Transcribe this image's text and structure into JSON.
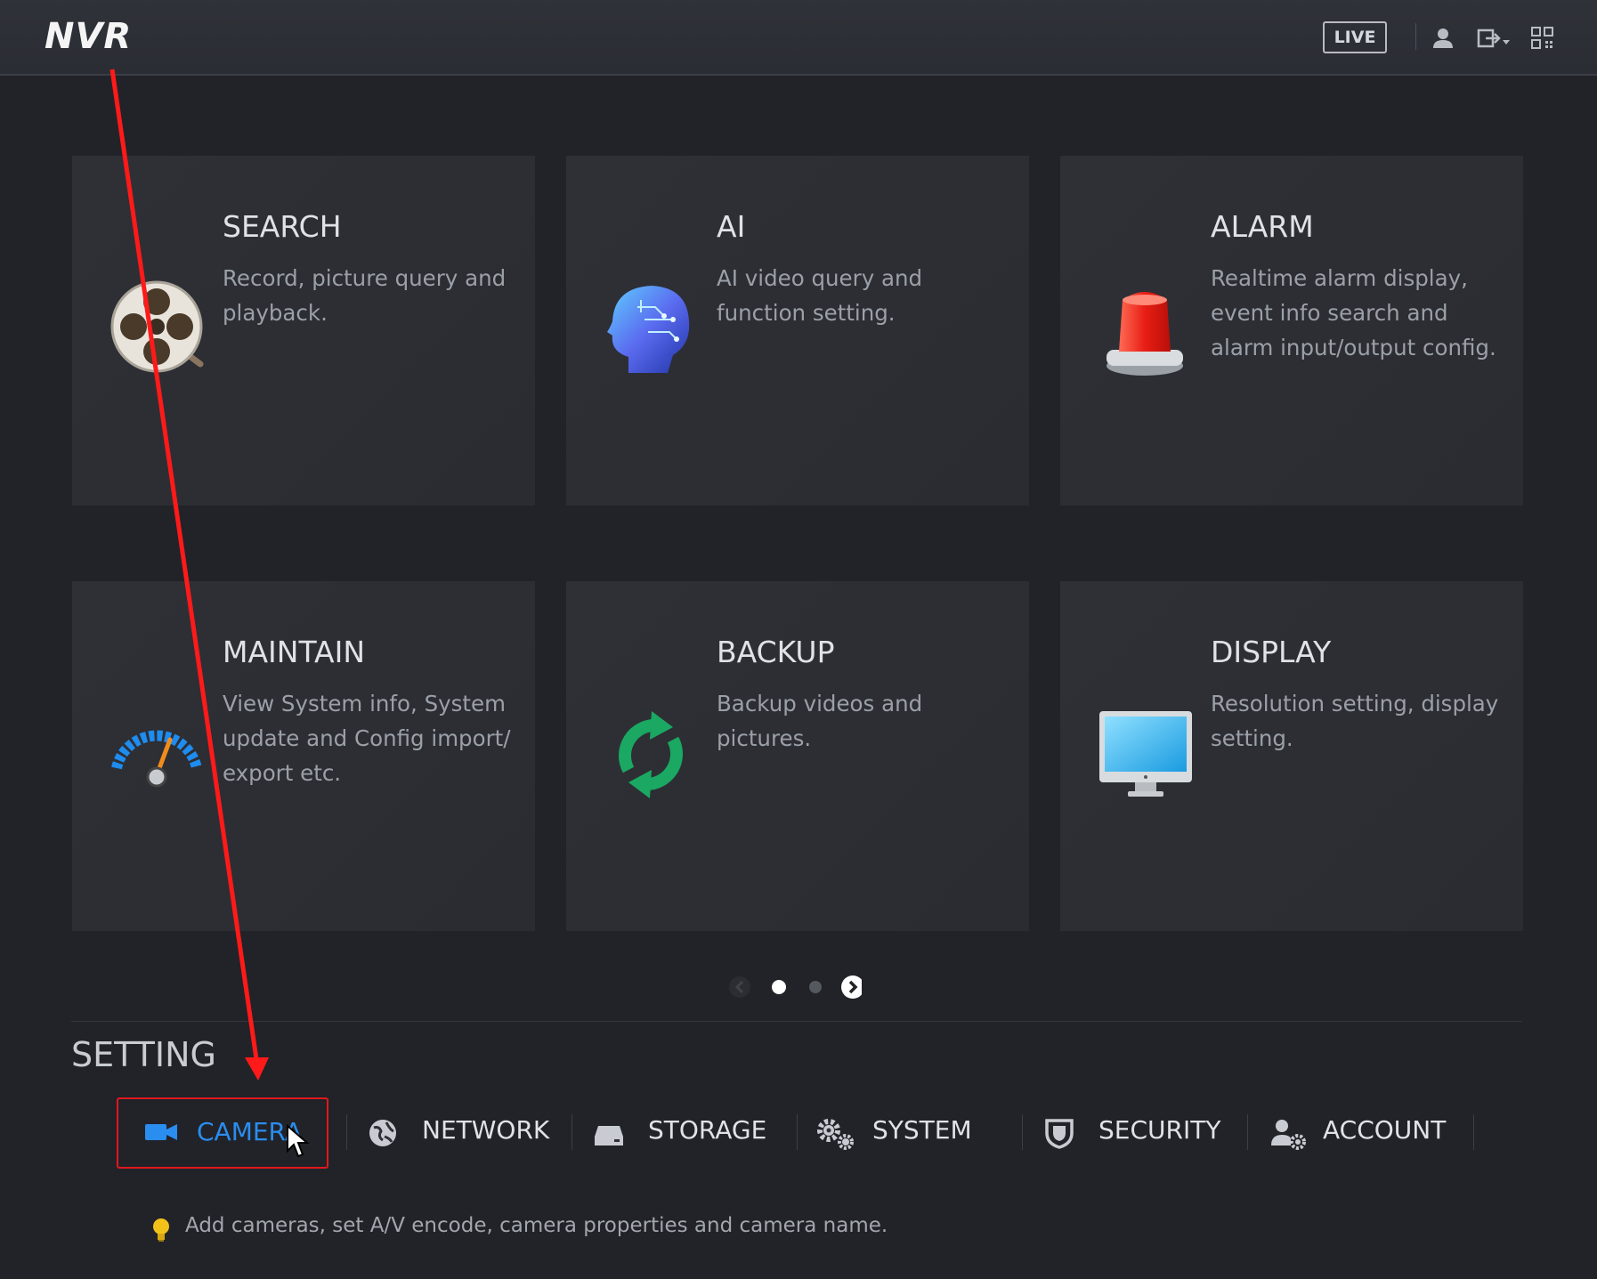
{
  "header": {
    "logo": "NVR",
    "live_label": "LIVE"
  },
  "cards": [
    {
      "title": "SEARCH",
      "desc": "Record, picture query and playback.",
      "icon": "film-reel-icon"
    },
    {
      "title": "AI",
      "desc": "AI video query and function setting.",
      "icon": "ai-head-icon"
    },
    {
      "title": "ALARM",
      "desc": "Realtime alarm display, event info search and alarm input/output config.",
      "icon": "alarm-light-icon"
    },
    {
      "title": "MAINTAIN",
      "desc": "View System info, System update and Config import/ export etc.",
      "icon": "gauge-icon"
    },
    {
      "title": "BACKUP",
      "desc": "Backup videos and pictures.",
      "icon": "refresh-arrows-icon"
    },
    {
      "title": "DISPLAY",
      "desc": "Resolution setting, display setting.",
      "icon": "monitor-icon"
    }
  ],
  "pager": {
    "pages": 2,
    "current": 1
  },
  "setting": {
    "title": "SETTING",
    "tabs": [
      {
        "label": "CAMERA",
        "icon": "video-camera-icon",
        "active": true
      },
      {
        "label": "NETWORK",
        "icon": "globe-icon",
        "active": false
      },
      {
        "label": "STORAGE",
        "icon": "hard-drive-icon",
        "active": false
      },
      {
        "label": "SYSTEM",
        "icon": "gears-icon",
        "active": false
      },
      {
        "label": "SECURITY",
        "icon": "shield-icon",
        "active": false
      },
      {
        "label": "ACCOUNT",
        "icon": "user-gear-icon",
        "active": false
      }
    ],
    "hint": "Add cameras, set A/V encode, camera properties and camera name."
  },
  "colors": {
    "active_tab_text": "#2a8df0",
    "highlight_border": "#e0181e",
    "background": "#212328"
  }
}
